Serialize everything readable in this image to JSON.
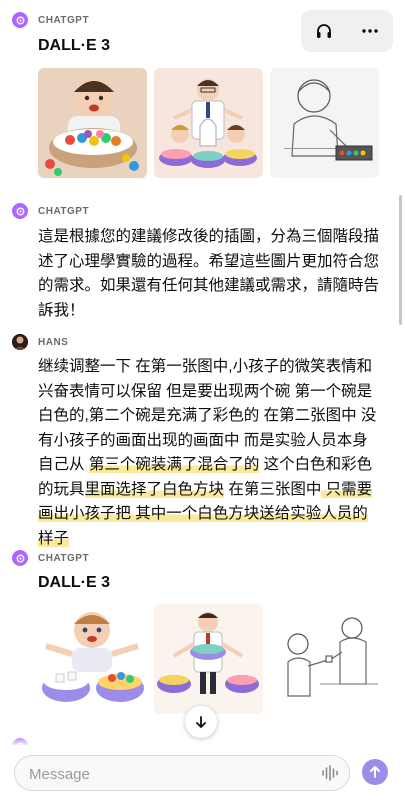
{
  "top_actions": {
    "headphones_icon": "headphones-icon",
    "more_icon": "ellipsis-icon"
  },
  "messages": [
    {
      "sender": "CHATGPT",
      "tool_title": "DALL·E 3",
      "images": [
        "Toddler with bowl of colorful toys",
        "Experimenter with two children and bowls",
        "Sketch of boy picking blocks"
      ]
    },
    {
      "sender": "CHATGPT",
      "text": "這是根據您的建議修改後的插圖，分為三個階段描述了心理學實驗的過程。希望這些圖片更加符合您的需求。如果還有任何其他建議或需求，請隨時告訴我！"
    },
    {
      "sender": "HANS",
      "text_parts": [
        "继续调整一下 在第一张图中,小孩子的微笑表情和兴奋表情可以保留 但是要出现两个碗 第一个碗是白色的,第二个碗是充满了彩色的 在第二张图中 没有小孩子的画面出现的画面中 而是实验人员本身自己从 ",
        "第三个碗装满了混合了的",
        " 这个白色和彩色的玩具",
        "里面选择了白色方块",
        " 在第三张图中",
        " 只需要画出小孩子把 其中一个白色方块送给实验人员的样子"
      ]
    },
    {
      "sender": "CHATGPT",
      "tool_title": "DALL·E 3",
      "images": [
        "Baby with white and colorful bowls",
        "Experimenter with mixed bowl",
        "Sketch of child handing block to experimenter"
      ]
    }
  ],
  "composer": {
    "placeholder": "Message"
  },
  "colors": {
    "accent": "#ab68ff",
    "highlight": "#fbe99a",
    "send": "#9c8ee8"
  }
}
